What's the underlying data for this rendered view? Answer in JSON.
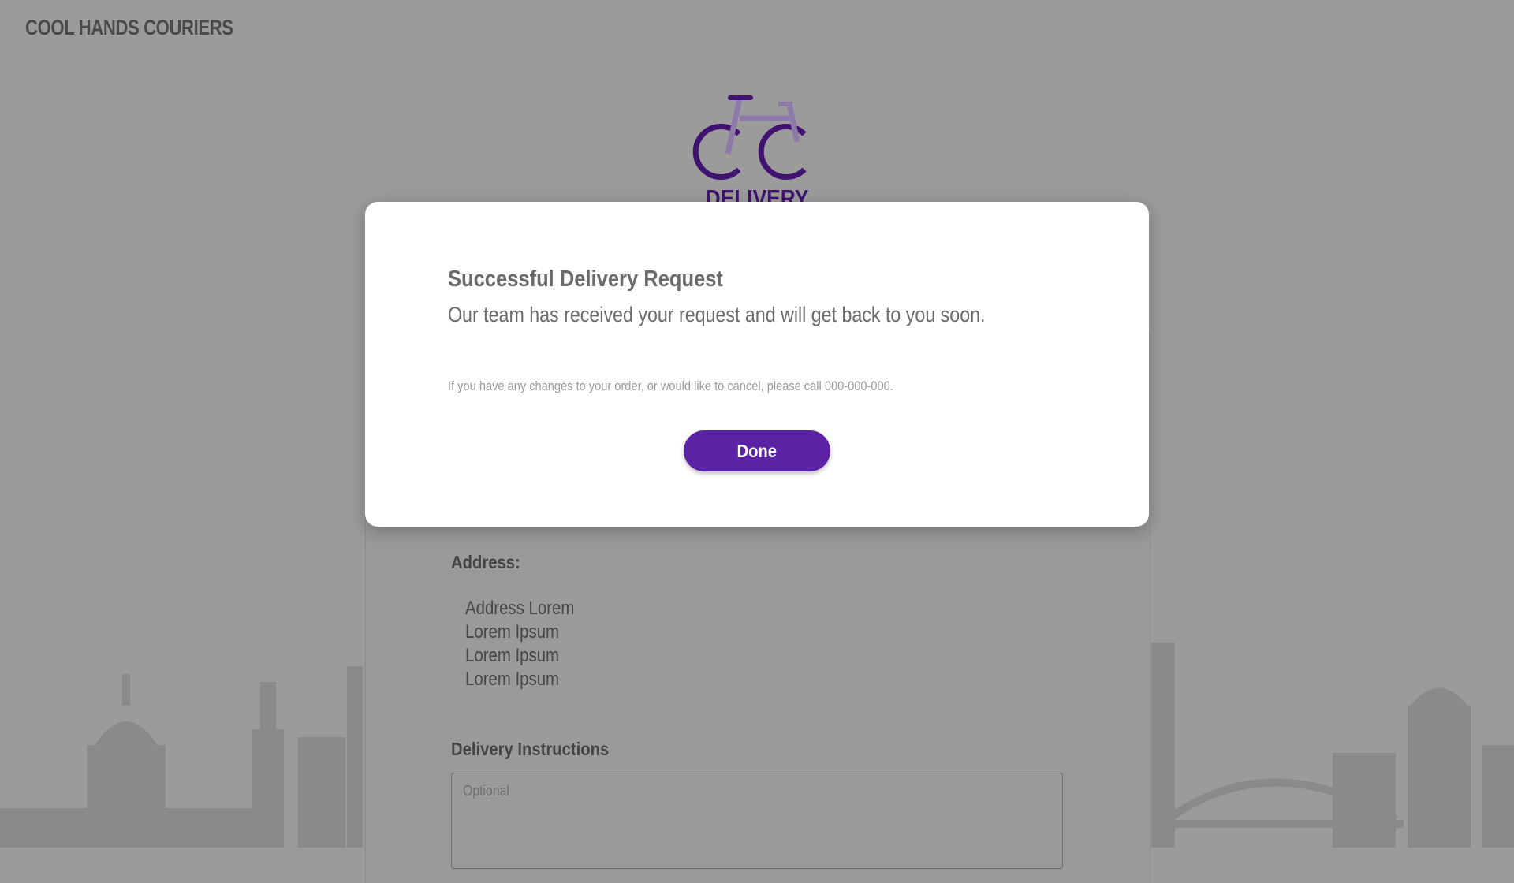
{
  "header": {
    "brand": "COOL HANDS COURIERS"
  },
  "logo": {
    "title": "DELIVERY ORDER",
    "icon": "bicycle-icon"
  },
  "form": {
    "address_label": "Address:",
    "address_lines": [
      "Address Lorem",
      "Lorem Ipsum",
      "Lorem Ipsum",
      "Lorem Ipsum"
    ],
    "instructions_label": "Delivery Instructions",
    "instructions_placeholder": "Optional"
  },
  "modal": {
    "title": "Successful Delivery Request",
    "subtitle": "Our team has received your request and will get back to you soon.",
    "note": "If you have any changes to your order, or would like to cancel, please call 000-000-000.",
    "done_label": "Done"
  },
  "colors": {
    "accent": "#5b22a6",
    "logo": "#3f136f",
    "overlay": "#9b9b9b"
  }
}
